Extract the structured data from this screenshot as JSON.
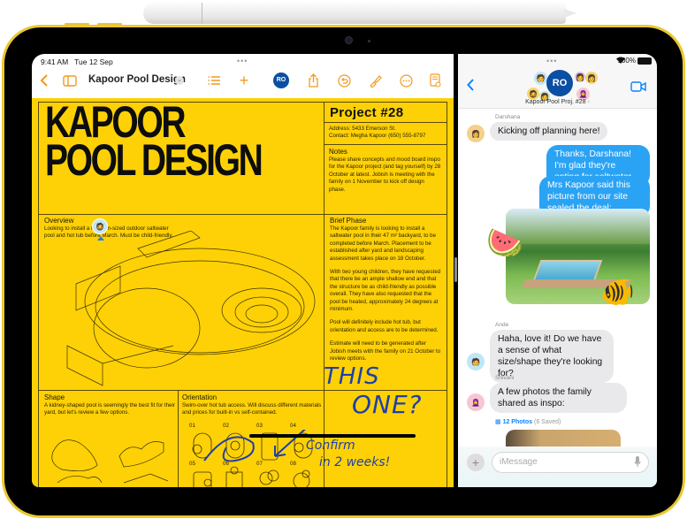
{
  "status_bar": {
    "time": "9:41 AM",
    "date": "Tue 12 Sep",
    "battery": "100%"
  },
  "pages": {
    "toolbar": {
      "doc_title": "Kapoor Pool Design",
      "collab_badge": "RO",
      "icons": [
        "back-chevron-icon",
        "sidebar-icon",
        "list-icon",
        "plus-icon",
        "collaborate-icon",
        "share-icon",
        "undo-icon",
        "brush-icon",
        "more-icon",
        "document-view-icon"
      ]
    },
    "document": {
      "title_line1": "KAPOOR",
      "title_line2": "POOL DESIGN",
      "project": "Project #28",
      "address": "Address: 5433 Emerson St.",
      "contact": "Contact: Megha Kapoor (650) 555-8797",
      "notes_heading": "Notes",
      "notes_body": "Please share concepts and mood board inspo for the Kapoor project (and tag yourself) by 28 October at latest. Jobish is meeting with the family on 1 November to kick off design phase.",
      "overview_heading": "Overview",
      "overview_body": "Looking to install a medium-sized outdoor saltwater pool and hot tub before March. Must be child-friendly.",
      "brief_heading": "Brief Phase",
      "brief_p1": "The Kapoor family is looking to install a saltwater pool in their 47 m² backyard, to be completed before March. Placement to be established after yard and landscaping assessment takes place on 18 October.",
      "brief_p2": "With two young children, they have requested that there be an ample shallow end and that the structure be as child-friendly as possible overall. They have also requested that the pool be heated, approximately 24 degrees at minimum.",
      "brief_p3": "Pool will definitely include hot tub, but orientation and access are to be determined.",
      "brief_p4": "Estimate will need to be generated after Jobish meets with the family on 21 October to review options.",
      "shape_heading": "Shape",
      "shape_body": "A kidney-shaped pool is seemingly the best fit for their yard, but let's review a few options.",
      "orientation_heading": "Orientation",
      "orientation_body": "Swim-over hot tub access. Will discuss different materials and prices for built-in vs self-contained.",
      "orientation_labels": [
        "01",
        "02",
        "03",
        "04",
        "05",
        "06",
        "07",
        "08"
      ],
      "handwriting": {
        "line1": "THIS",
        "line2": "ONE?",
        "note1": "Confirm",
        "note2": "in 2 weeks!"
      }
    }
  },
  "messages": {
    "group_name": "Kapoor Pool Proj. #28",
    "group_badge": "RO",
    "thread": [
      {
        "sender": "Darshana",
        "text": "Kicking off planning here!",
        "direction": "in"
      },
      {
        "text": "Thanks, Darshana! I'm glad they're opting for saltwater.",
        "direction": "out"
      },
      {
        "text": "Mrs Kapoor said this picture from our site sealed the deal:",
        "direction": "out"
      },
      {
        "type": "image",
        "description": "backyard pool photo with watermelon and fish stickers"
      },
      {
        "sender": "Ande",
        "text": "Haha, love it! Do we have a sense of what size/shape they're looking for?",
        "direction": "in"
      },
      {
        "sender": "Shivani",
        "text": "A few photos the family shared as inspo:",
        "direction": "in"
      }
    ],
    "photos_link": "12 Photos",
    "photos_saved": "(6 Saved)",
    "input_placeholder": "iMessage",
    "colors": {
      "outgoing": "#2aa3f5",
      "incoming": "#e9e9eb",
      "accent": "#0a84ff"
    }
  },
  "colors": {
    "document_bg": "#fed106",
    "toolbar_accent": "#f29a1f",
    "device_frame": "#e9c834"
  }
}
